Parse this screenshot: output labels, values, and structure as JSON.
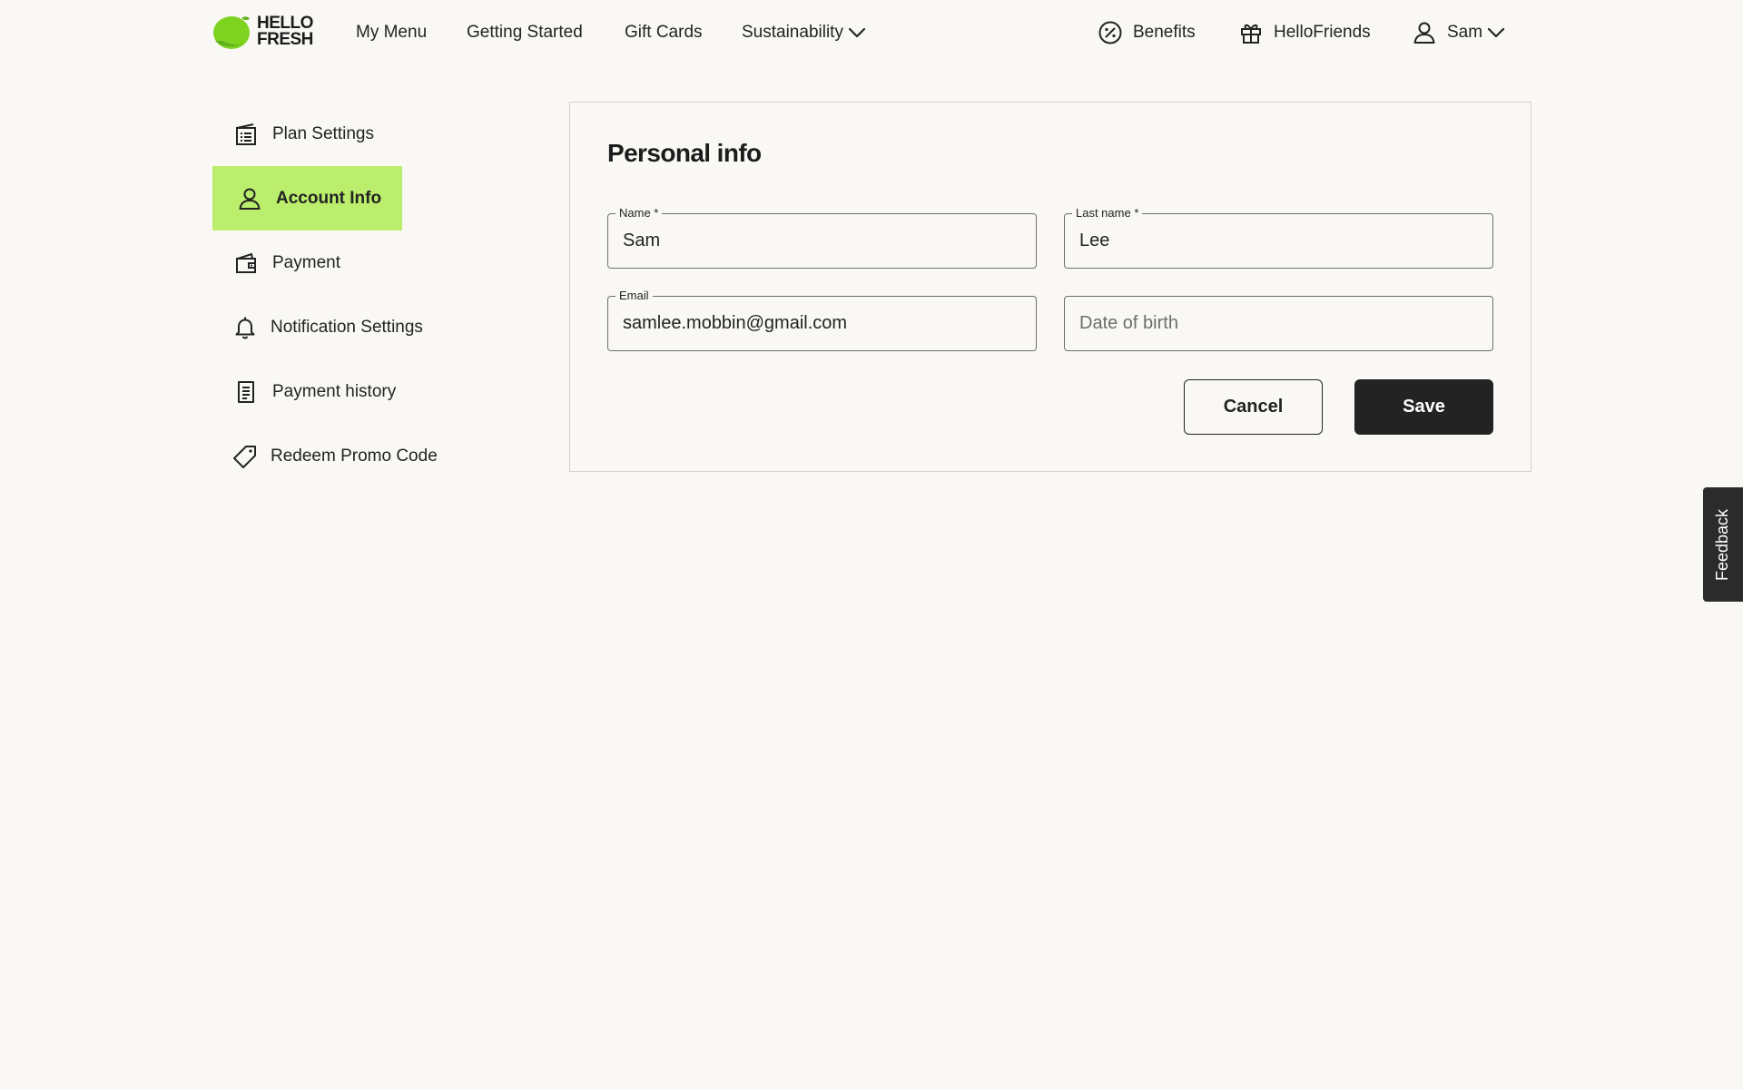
{
  "brand": {
    "logo_line1": "HELLO",
    "logo_line2": "FRESH",
    "accent_color": "#bbee6c",
    "logo_green": "#7ed321"
  },
  "header": {
    "nav": [
      {
        "label": "My Menu"
      },
      {
        "label": "Getting Started"
      },
      {
        "label": "Gift Cards"
      },
      {
        "label": "Sustainability",
        "icon": "chevron-down-icon"
      }
    ],
    "right": [
      {
        "label": "Benefits",
        "icon": "percent-badge-icon"
      },
      {
        "label": "HelloFriends",
        "icon": "gift-icon"
      },
      {
        "label": "Sam",
        "icon": "user-icon",
        "trailing_icon": "chevron-down-icon"
      }
    ]
  },
  "sidebar": {
    "items": [
      {
        "label": "Plan Settings",
        "icon": "calendar-box-icon",
        "active": false
      },
      {
        "label": "Account Info",
        "icon": "user-icon",
        "active": true
      },
      {
        "label": "Payment",
        "icon": "wallet-icon",
        "active": false
      },
      {
        "label": "Notification Settings",
        "icon": "bell-icon",
        "active": false
      },
      {
        "label": "Payment history",
        "icon": "receipt-icon",
        "active": false
      },
      {
        "label": "Redeem Promo Code",
        "icon": "tag-icon",
        "active": false
      }
    ]
  },
  "form": {
    "title": "Personal info",
    "first_name": {
      "label": "Name *",
      "value": "Sam"
    },
    "last_name": {
      "label": "Last name *",
      "value": "Lee"
    },
    "email": {
      "label": "Email",
      "value": "samlee.mobbin@gmail.com"
    },
    "dob": {
      "placeholder": "Date of birth",
      "value": ""
    },
    "cancel_label": "Cancel",
    "save_label": "Save"
  },
  "feedback": {
    "label": "Feedback"
  }
}
